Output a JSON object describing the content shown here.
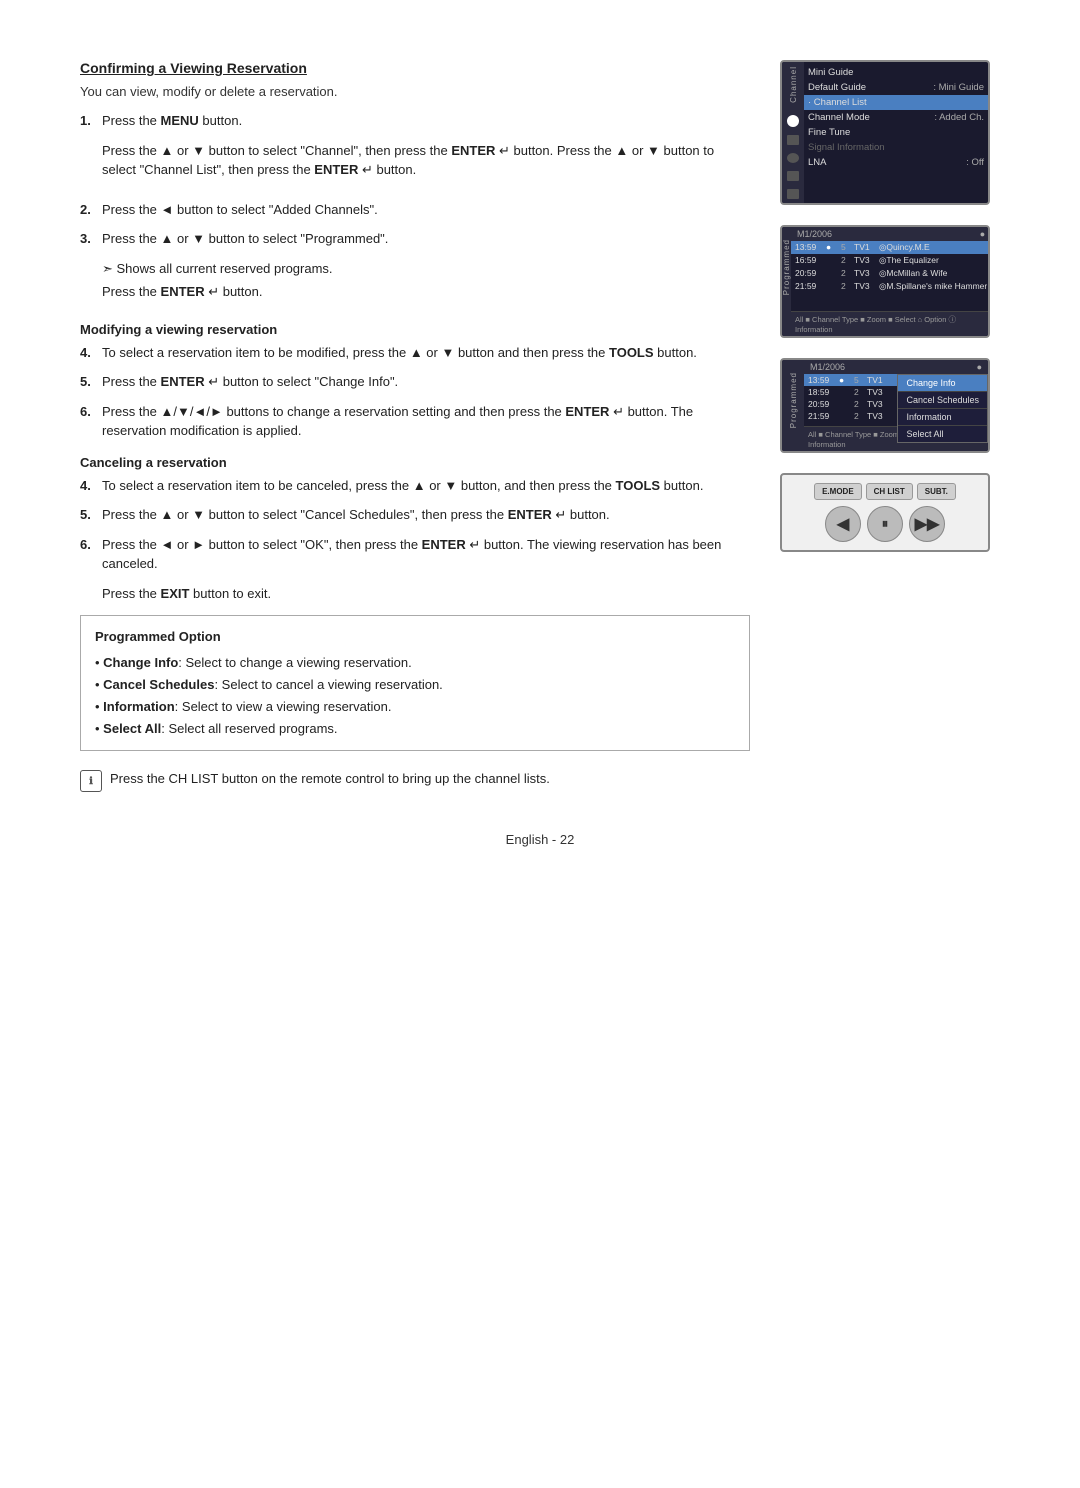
{
  "page": {
    "title": "Confirming a Viewing Reservation",
    "footer": "English - 22"
  },
  "content": {
    "section_title": "Confirming a Viewing Reservation",
    "intro": "You can view, modify or delete a reservation.",
    "steps": [
      {
        "num": "1.",
        "text_plain": "Press the ",
        "text_bold": "MENU",
        "text_after": " button.",
        "sub": "Press the ▲ or ▼ button to select \"Channel\", then press the ENTER ↵ button. Press the ▲ or ▼ button to select \"Channel List\", then press the ENTER ↵ button."
      },
      {
        "num": "2.",
        "text_plain": "Press the ◄ button to select \"Added Channels\"."
      },
      {
        "num": "3.",
        "text_plain": "Press the ▲ or ▼ button to select \"Programmed\".",
        "note_arrow": "➣  Shows all current reserved programs.",
        "note_press": "Press the ENTER ↵ button."
      }
    ],
    "modifying_title": "Modifying a viewing reservation",
    "modifying_steps": [
      {
        "num": "4.",
        "text": "To select a reservation item to be modified, press the ▲ or ▼ button and then press the TOOLS button."
      },
      {
        "num": "5.",
        "text": "Press the ENTER ↵ button to select \"Change Info\"."
      },
      {
        "num": "6.",
        "text": "Press the ▲/▼/◄/► buttons to change a reservation setting and then press the ENTER ↵ button. The reservation modification is applied."
      }
    ],
    "canceling_title": "Canceling a reservation",
    "canceling_steps": [
      {
        "num": "4.",
        "text": "To select a reservation item to be canceled, press the ▲ or ▼ button, and then press the TOOLS button."
      },
      {
        "num": "5.",
        "text": "Press the ▲ or ▼ button to select \"Cancel Schedules\", then press the ENTER ↵ button."
      },
      {
        "num": "6.",
        "text": "Press the ◄ or ► button to select \"OK\", then press the ENTER ↵ button. The viewing reservation has been canceled."
      }
    ],
    "exit_note": "Press the EXIT button to exit.",
    "programmed_option_title": "Programmed Option",
    "programmed_options": [
      "Change Info: Select to change a viewing reservation.",
      "Cancel Schedules: Select to cancel a viewing reservation.",
      "Information: Select to view a viewing reservation.",
      "Select All: Select all reserved programs."
    ],
    "bottom_note": "Press the CH LIST button on the remote control to bring up the channel lists."
  },
  "channel_menu": {
    "title": "Channel",
    "items": [
      {
        "label": "Mini Guide",
        "value": "",
        "highlighted": false,
        "icon": "circle"
      },
      {
        "label": "Default Guide",
        "value": ": Mini Guide",
        "highlighted": false,
        "icon": "circle"
      },
      {
        "label": "Channel List",
        "value": "",
        "highlighted": true,
        "icon": "none"
      },
      {
        "label": "Channel Mode",
        "value": ": Added Ch.",
        "highlighted": false,
        "icon": "gear"
      },
      {
        "label": "Fine Tune",
        "value": "",
        "highlighted": false,
        "icon": "none"
      },
      {
        "label": "Signal Information",
        "value": "",
        "highlighted": false,
        "icon": "none"
      },
      {
        "label": "LNA",
        "value": ": Off",
        "highlighted": false,
        "icon": "tv"
      }
    ]
  },
  "programmed_screen1": {
    "sidebar_label": "Programmed",
    "date": "M1/2006",
    "rows": [
      {
        "time": "13:59",
        "ch": "●",
        "num": "5",
        "tv": "TV1",
        "show": "◎Quincy.M.E",
        "highlighted": true
      },
      {
        "time": "16:59",
        "ch": "",
        "num": "2",
        "tv": "TV3",
        "show": "◎The Equalizer",
        "highlighted": false
      },
      {
        "time": "20:59",
        "ch": "",
        "num": "2",
        "tv": "TV3",
        "show": "◎McMillan & Wife",
        "highlighted": false
      },
      {
        "time": "21:59",
        "ch": "",
        "num": "2",
        "tv": "TV3",
        "show": "◎M.Spillane's Mike Hammer",
        "highlighted": false
      }
    ],
    "footer": "All ■ Channel Type ■ Zoom ■ Select ⌂ Option ⓘ Information"
  },
  "programmed_screen2": {
    "sidebar_label": "Programmed",
    "date": "M1/2006",
    "rows": [
      {
        "time": "13:59",
        "ch": "●",
        "num": "5",
        "tv": "TV1",
        "show": "Change Info",
        "highlighted": true,
        "context": true
      },
      {
        "time": "18:59",
        "ch": "",
        "num": "2",
        "tv": "TV3",
        "show": "",
        "highlighted": false
      },
      {
        "time": "20:59",
        "ch": "",
        "num": "2",
        "tv": "TV3",
        "show": "",
        "highlighted": false
      },
      {
        "time": "21:59",
        "ch": "",
        "num": "2",
        "tv": "TV3",
        "show": "",
        "highlighted": false
      }
    ],
    "context_menu": [
      "Change Info",
      "Cancel Schedules",
      "Information",
      "Select All"
    ],
    "context_selected": "Change Info",
    "footer": "All ■ Channel Type ■ Zoom ■ Select ⌂ Option ⓘ Information"
  },
  "remote": {
    "buttons_row1": [
      "E.MODE",
      "CH LIST",
      "SUBT."
    ],
    "nav_prev": "◀",
    "nav_pause": "⏸",
    "nav_next": "▶▶"
  }
}
